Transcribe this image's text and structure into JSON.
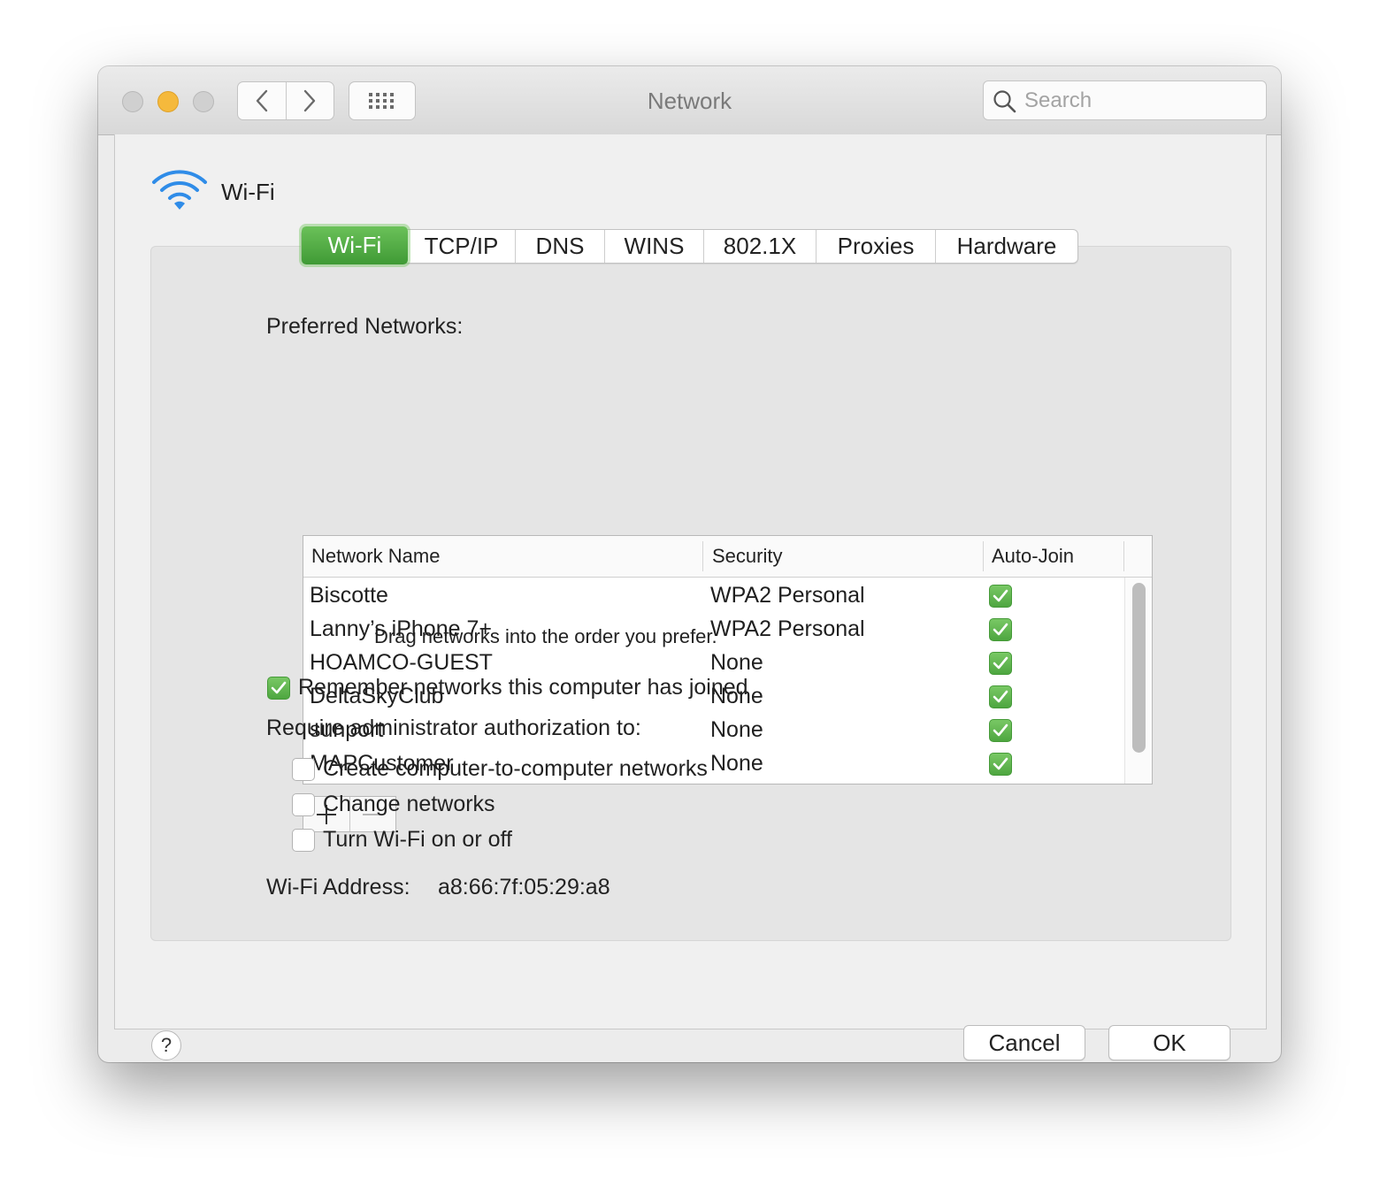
{
  "window": {
    "title": "Network"
  },
  "search": {
    "placeholder": "Search"
  },
  "service": {
    "name": "Wi-Fi"
  },
  "tabs": [
    "Wi-Fi",
    "TCP/IP",
    "DNS",
    "WINS",
    "802.1X",
    "Proxies",
    "Hardware"
  ],
  "active_tab": "Wi-Fi",
  "preferred": {
    "label": "Preferred Networks:",
    "columns": {
      "name": "Network Name",
      "security": "Security",
      "autojoin": "Auto-Join"
    },
    "rows": [
      {
        "name": "Biscotte",
        "security": "WPA2 Personal",
        "auto_join": true
      },
      {
        "name": "Lanny’s iPhone 7+",
        "security": "WPA2 Personal",
        "auto_join": true
      },
      {
        "name": "HOAMCO-GUEST",
        "security": "None",
        "auto_join": true
      },
      {
        "name": "DeltaSkyClub",
        "security": "None",
        "auto_join": true
      },
      {
        "name": "sunport",
        "security": "None",
        "auto_join": true
      },
      {
        "name": "MAPCustomer",
        "security": "None",
        "auto_join": true
      }
    ],
    "drag_hint": "Drag networks into the order you prefer."
  },
  "remember": {
    "label": "Remember networks this computer has joined",
    "checked": true
  },
  "require": {
    "label": "Require administrator authorization to:",
    "create_label": "Create computer-to-computer networks",
    "change_label": "Change networks",
    "toggle_label": "Turn Wi-Fi on or off"
  },
  "address": {
    "label": "Wi-Fi Address:",
    "value": "a8:66:7f:05:29:a8"
  },
  "buttons": {
    "help": "?",
    "cancel": "Cancel",
    "ok": "OK"
  },
  "colors": {
    "accent_green": "#4ea640",
    "wifi_blue": "#2f8ce8",
    "minimize_yellow": "#f5b93c"
  }
}
